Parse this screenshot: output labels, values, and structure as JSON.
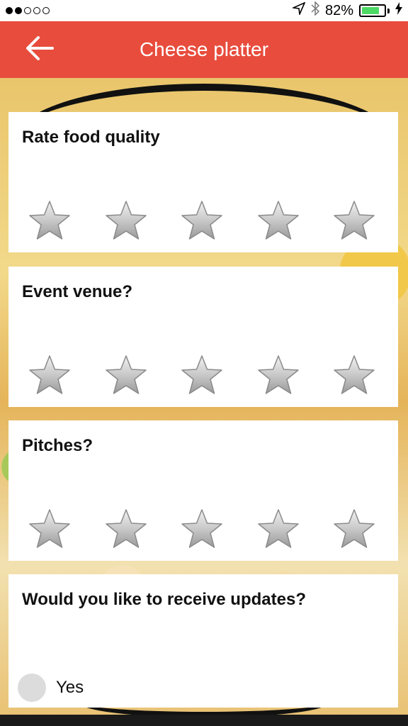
{
  "status_bar": {
    "battery_percent": "82%",
    "battery_level": 0.82
  },
  "nav": {
    "title": "Cheese platter",
    "back_icon": "arrow-left-icon"
  },
  "questions": [
    {
      "title": "Rate food quality",
      "rating": 0,
      "max": 5
    },
    {
      "title": "Event venue?",
      "rating": 0,
      "max": 5
    },
    {
      "title": "Pitches?",
      "rating": 0,
      "max": 5
    }
  ],
  "updates": {
    "title": "Would you like to receive updates?",
    "option_label": "Yes",
    "selected": false
  },
  "colors": {
    "accent": "#e84c3d",
    "star": "#b8b8b8",
    "radio": "#dcdcdc"
  }
}
